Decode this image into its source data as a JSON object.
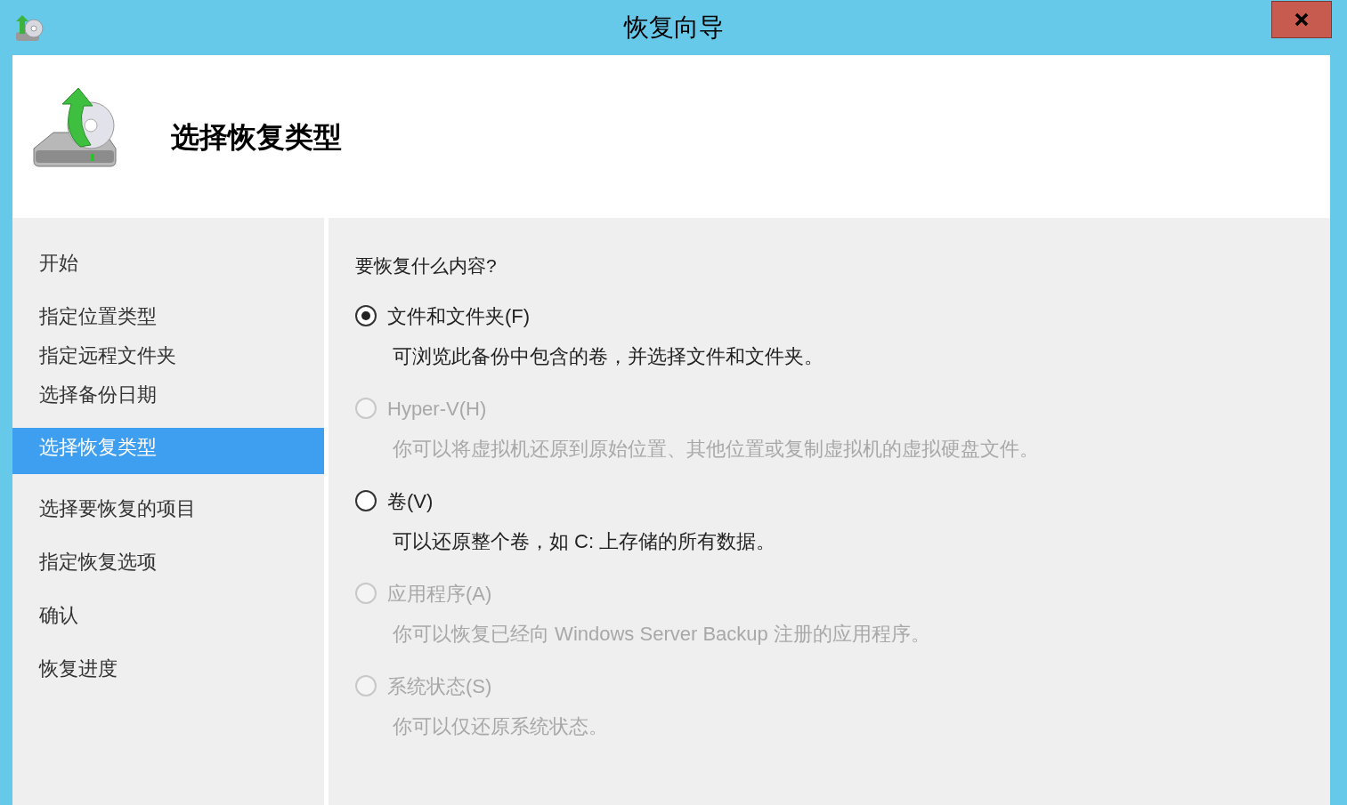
{
  "window": {
    "title": "恢复向导"
  },
  "header": {
    "title": "选择恢复类型"
  },
  "sidebar": {
    "groups": [
      [
        {
          "label": "开始",
          "selected": false
        }
      ],
      [
        {
          "label": "指定位置类型",
          "selected": false
        },
        {
          "label": "指定远程文件夹",
          "selected": false
        },
        {
          "label": "选择备份日期",
          "selected": false
        }
      ],
      [
        {
          "label": "选择恢复类型",
          "selected": true
        }
      ],
      [
        {
          "label": "选择要恢复的项目",
          "selected": false
        }
      ],
      [
        {
          "label": "指定恢复选项",
          "selected": false
        }
      ],
      [
        {
          "label": "确认",
          "selected": false
        }
      ],
      [
        {
          "label": "恢复进度",
          "selected": false
        }
      ]
    ]
  },
  "content": {
    "question": "要恢复什么内容?",
    "options": [
      {
        "label": "文件和文件夹(F)",
        "description": "可浏览此备份中包含的卷，并选择文件和文件夹。",
        "selected": true,
        "disabled": false
      },
      {
        "label": "Hyper-V(H)",
        "description": "你可以将虚拟机还原到原始位置、其他位置或复制虚拟机的虚拟硬盘文件。",
        "selected": false,
        "disabled": true
      },
      {
        "label": "卷(V)",
        "description": "可以还原整个卷，如 C: 上存储的所有数据。",
        "selected": false,
        "disabled": false
      },
      {
        "label": "应用程序(A)",
        "description": "你可以恢复已经向 Windows Server Backup 注册的应用程序。",
        "selected": false,
        "disabled": true
      },
      {
        "label": "系统状态(S)",
        "description": "你可以仅还原系统状态。",
        "selected": false,
        "disabled": true
      }
    ]
  }
}
